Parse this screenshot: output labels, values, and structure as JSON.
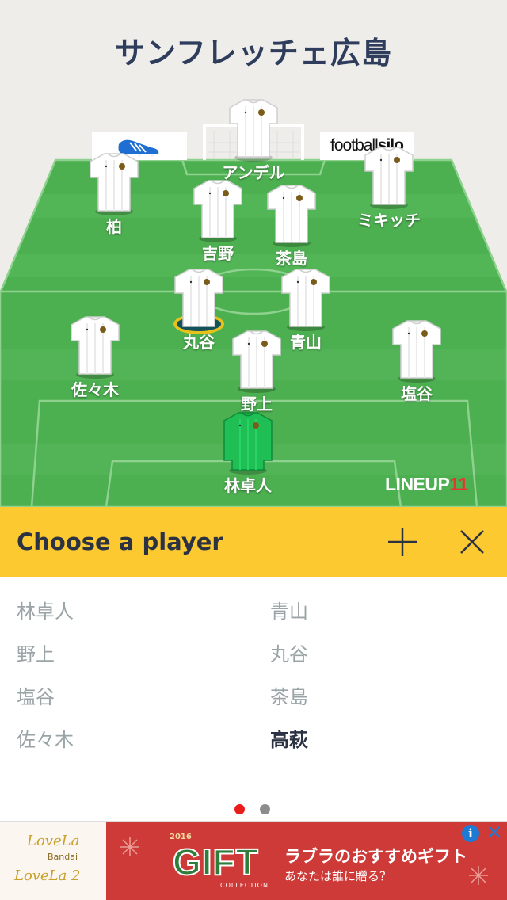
{
  "header": {
    "team_name": "サンフレッチェ広島"
  },
  "sponsors": {
    "right_thin": "football",
    "right_bold": "silo"
  },
  "formation_players": [
    {
      "name": "アンデル",
      "kit": "outfield",
      "selected": false
    },
    {
      "name": "柏",
      "kit": "outfield",
      "selected": false
    },
    {
      "name": "ミキッチ",
      "kit": "outfield",
      "selected": false
    },
    {
      "name": "吉野",
      "kit": "outfield",
      "selected": false
    },
    {
      "name": "茶島",
      "kit": "outfield",
      "selected": false
    },
    {
      "name": "丸谷",
      "kit": "outfield",
      "selected": true
    },
    {
      "name": "青山",
      "kit": "outfield",
      "selected": false
    },
    {
      "name": "佐々木",
      "kit": "outfield",
      "selected": false
    },
    {
      "name": "塩谷",
      "kit": "outfield",
      "selected": false
    },
    {
      "name": "野上",
      "kit": "outfield",
      "selected": false
    },
    {
      "name": "林卓人",
      "kit": "goalkeeper",
      "selected": false
    }
  ],
  "brand": {
    "text": "LINEUP",
    "number": "11"
  },
  "chooser": {
    "title": "Choose a player",
    "add_icon": "plus-icon",
    "close_icon": "close-icon"
  },
  "player_list": {
    "left": [
      "林卓人",
      "野上",
      "塩谷",
      "佐々木"
    ],
    "right": [
      "青山",
      "丸谷",
      "茶島",
      "高萩"
    ],
    "active_name": "高萩"
  },
  "pager": {
    "current_page": 1,
    "total_pages": 2
  },
  "ad": {
    "logo_top": "LoveLa",
    "logo_top_sub": "Bandai",
    "logo_bottom": "LoveLa 2",
    "year": "2016",
    "headline": "GIFT",
    "collection": "COLLECTION",
    "tagline": "ラブラのおすすめギフト",
    "subline": "あなたは誰に贈る？",
    "info_icon": "info-icon",
    "close_icon": "close-icon"
  },
  "colors": {
    "title": "#2e3d5c",
    "grass": "#4caf50",
    "grass_light": "#58b95b",
    "chooser_bar": "#fcca30",
    "selected_ring": "#e7c21b",
    "list_inactive": "#9aa4a6",
    "list_active": "#2b3242",
    "dot_active": "#ea1b1b",
    "brand_accent": "#e8352f",
    "goalkeeper_kit": "#1fbf55"
  }
}
